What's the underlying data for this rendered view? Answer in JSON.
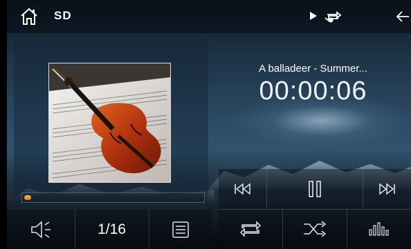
{
  "topbar": {
    "source_label": "SD"
  },
  "now_playing": {
    "title": "A balladeer - Summer...",
    "elapsed": "00:00:06",
    "progress_fraction": 0.03
  },
  "controls": {
    "track_counter": "1/16"
  },
  "colors": {
    "progress_border": "#d52a1e",
    "progress_fill": "#f0a030",
    "text": "#ffffff"
  },
  "icons": [
    "home-icon",
    "play-state-icon",
    "repeat-state-icon",
    "back-arrow-icon",
    "previous-track-icon",
    "pause-icon",
    "next-track-icon",
    "volume-icon",
    "playlist-icon",
    "repeat-icon",
    "shuffle-icon",
    "equalizer-icon"
  ]
}
